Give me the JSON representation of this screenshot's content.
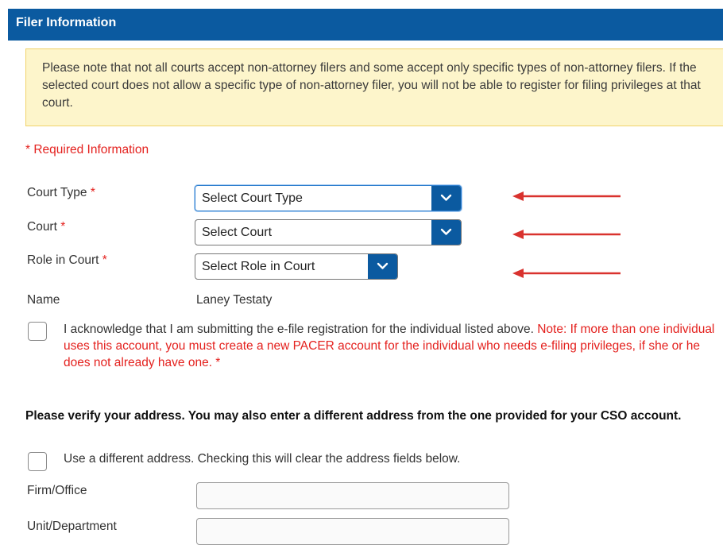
{
  "header": {
    "title": "Filer Information"
  },
  "notice": {
    "text": "Please note that not all courts accept non-attorney filers and some accept only specific types of non-attorney filers. If the selected court does not allow a specific type of non-attorney filer, you will not be able to register for filing privileges at that court."
  },
  "required_info": "* Required Information",
  "required_marker": "*",
  "fields": {
    "court_type": {
      "label": "Court Type",
      "selected": "Select Court Type"
    },
    "court": {
      "label": "Court",
      "selected": "Select Court"
    },
    "role": {
      "label": "Role in Court",
      "selected": "Select Role in Court"
    },
    "name": {
      "label": "Name",
      "value": "Laney Testaty"
    }
  },
  "acknowledge": {
    "text": "I acknowledge that I am submitting the e-file registration for the individual listed above.",
    "note": "Note: If more than one individual uses this account, you must create a new PACER account for the individual who needs e-filing privileges, if she or he does not already have one.",
    "required": " *"
  },
  "address": {
    "verify_text": "Please verify your address. You may also enter a different address from the one provided for your CSO account.",
    "different_text": "Use a different address. Checking this will clear the address fields below.",
    "firm_label": "Firm/Office",
    "unit_label": "Unit/Department"
  },
  "colors": {
    "header": "#0b5aa0",
    "required": "#e4211e",
    "arrow": "#d9322e",
    "notice_bg": "#fdf5cb"
  }
}
